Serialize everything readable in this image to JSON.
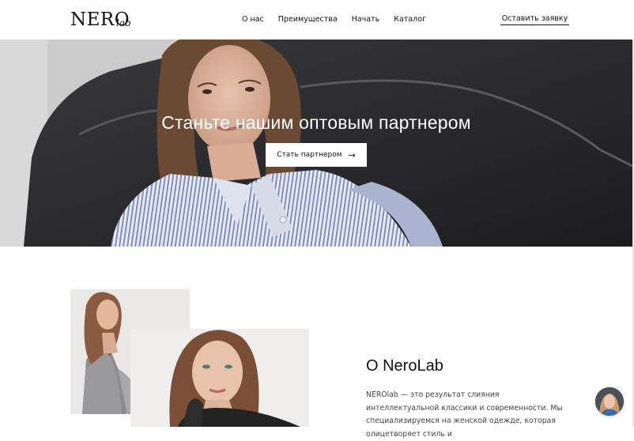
{
  "header": {
    "logo_main": "NERO",
    "logo_sub": "lab",
    "nav": [
      "О нас",
      "Преимущества",
      "Начать",
      "Каталог"
    ],
    "cta": "Оставить заявку"
  },
  "hero": {
    "title": "Станьте нашим оптовым партнером",
    "button_label": "Стать партнером",
    "button_icon": "arrow-right-icon"
  },
  "about": {
    "title": "О NeroLab",
    "text": "NEROlab — это результат слияния интеллектуальной классики и современности. Мы специализируемся на женской одежде, которая олицетворяет стиль и"
  },
  "chat": {
    "icon": "chat-avatar-icon"
  }
}
